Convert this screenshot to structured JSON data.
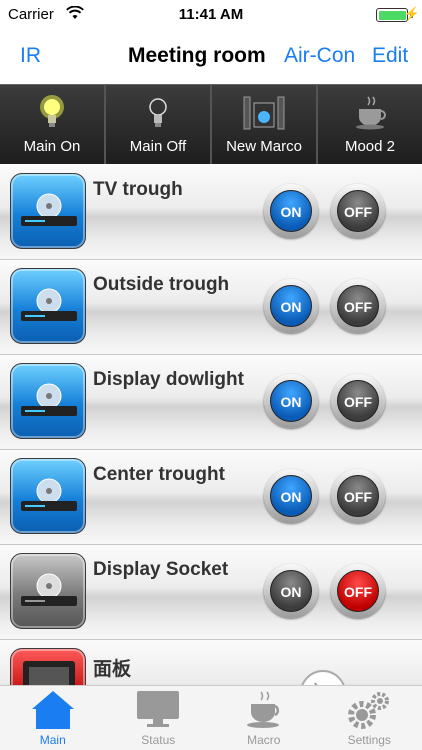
{
  "status_bar": {
    "carrier": "Carrier",
    "time": "11:41 AM"
  },
  "nav": {
    "left": "IR",
    "title": "Meeting room",
    "aircon": "Air-Con",
    "edit": "Edit"
  },
  "macros": [
    {
      "label": "Main On",
      "icon": "bulb-on-icon"
    },
    {
      "label": "Main Off",
      "icon": "bulb-off-icon"
    },
    {
      "label": "New Marco",
      "icon": "speakers-icon"
    },
    {
      "label": "Mood 2",
      "icon": "coffee-cup-icon"
    }
  ],
  "devices": [
    {
      "name": "TV trough",
      "on_label": "ON",
      "off_label": "OFF",
      "state": "on"
    },
    {
      "name": "Outside trough",
      "on_label": "ON",
      "off_label": "OFF",
      "state": "on"
    },
    {
      "name": "Display dowlight",
      "on_label": "ON",
      "off_label": "OFF",
      "state": "on"
    },
    {
      "name": "Center trought",
      "on_label": "ON",
      "off_label": "OFF",
      "state": "on"
    },
    {
      "name": "Display Socket",
      "on_label": "ON",
      "off_label": "OFF",
      "state": "off"
    },
    {
      "name": "面板"
    }
  ],
  "tabs": [
    {
      "label": "Main",
      "icon": "house-icon",
      "active": true
    },
    {
      "label": "Status",
      "icon": "monitor-icon"
    },
    {
      "label": "Macro",
      "icon": "coffee-cup-icon"
    },
    {
      "label": "Settings",
      "icon": "gears-icon"
    }
  ],
  "colors": {
    "accent": "#1a7ef2",
    "on_active": "#0a5bb5",
    "off_active": "#c00000",
    "macro_bar": "#2b2b2b"
  }
}
